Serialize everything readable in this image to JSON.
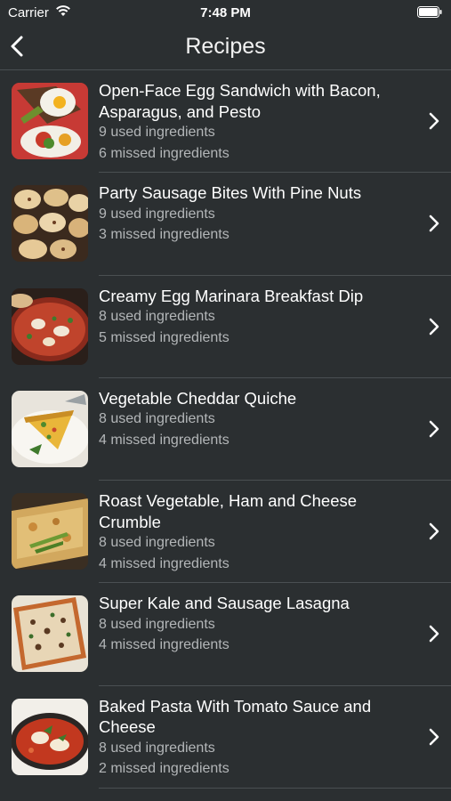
{
  "status_bar": {
    "carrier": "Carrier",
    "time": "7:48 PM"
  },
  "nav": {
    "title": "Recipes"
  },
  "recipes": [
    {
      "title": "Open-Face Egg Sandwich with Bacon, Asparagus, and Pesto",
      "used": "9 used ingredients",
      "missed": "6 missed ingredients"
    },
    {
      "title": "Party Sausage Bites With Pine Nuts",
      "used": "9 used ingredients",
      "missed": "3 missed ingredients"
    },
    {
      "title": "Creamy Egg Marinara Breakfast Dip",
      "used": "8 used ingredients",
      "missed": "5 missed ingredients"
    },
    {
      "title": "Vegetable Cheddar Quiche",
      "used": "8 used ingredients",
      "missed": "4 missed ingredients"
    },
    {
      "title": "Roast Vegetable, Ham and Cheese Crumble",
      "used": "8 used ingredients",
      "missed": "4 missed ingredients"
    },
    {
      "title": "Super Kale and Sausage Lasagna",
      "used": "8 used ingredients",
      "missed": "4 missed ingredients"
    },
    {
      "title": "Baked Pasta With Tomato Sauce and Cheese",
      "used": "8 used ingredients",
      "missed": "2 missed ingredients"
    }
  ],
  "colors": {
    "background": "#2b2f31",
    "separator": "#4a4f52",
    "secondary_text": "#b3b6b8"
  }
}
